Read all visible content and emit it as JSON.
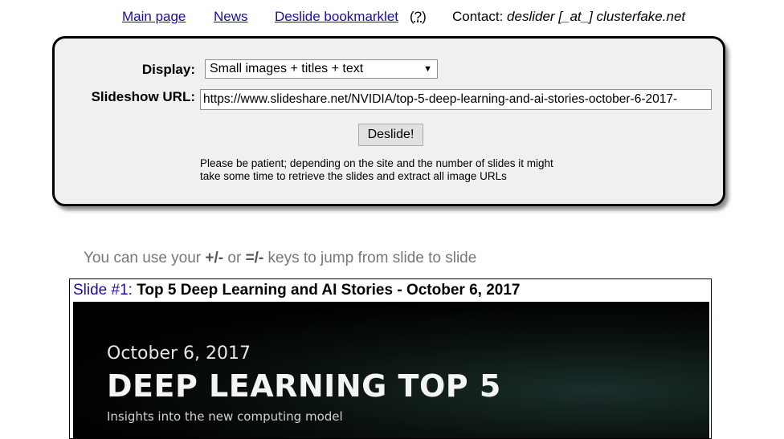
{
  "nav": {
    "main_page": "Main page",
    "news": "News",
    "bookmarklet": "Deslide bookmarklet",
    "paren_open": "(",
    "help": "?",
    "paren_close": ")",
    "contact_label": "Contact:",
    "contact_address": "deslider [_at_] clusterfake.net"
  },
  "form": {
    "display_label": "Display:",
    "display_value": "Small images + titles + text",
    "url_label": "Slideshow URL:",
    "url_value": "https://www.slideshare.net/NVIDIA/top-5-deep-learning-and-ai-stories-october-6-2017-",
    "submit_label": "Deslide!",
    "note_line1": "Please be patient; depending on the site and the number of slides it might",
    "note_line2": "take some time to retrieve the slides and extract all image URLs"
  },
  "hint": {
    "pre": "You can use your ",
    "key1": "+/-",
    "mid": " or ",
    "key2": "=/-",
    "post": " keys to jump from slide to slide"
  },
  "slide": {
    "number_label": "Slide #1:",
    "title": "Top 5 Deep Learning and AI Stories - October 6, 2017",
    "image": {
      "date": "October 6, 2017",
      "headline": "DEEP LEARNING TOP 5",
      "subtitle": "Insights into the new computing model"
    }
  }
}
